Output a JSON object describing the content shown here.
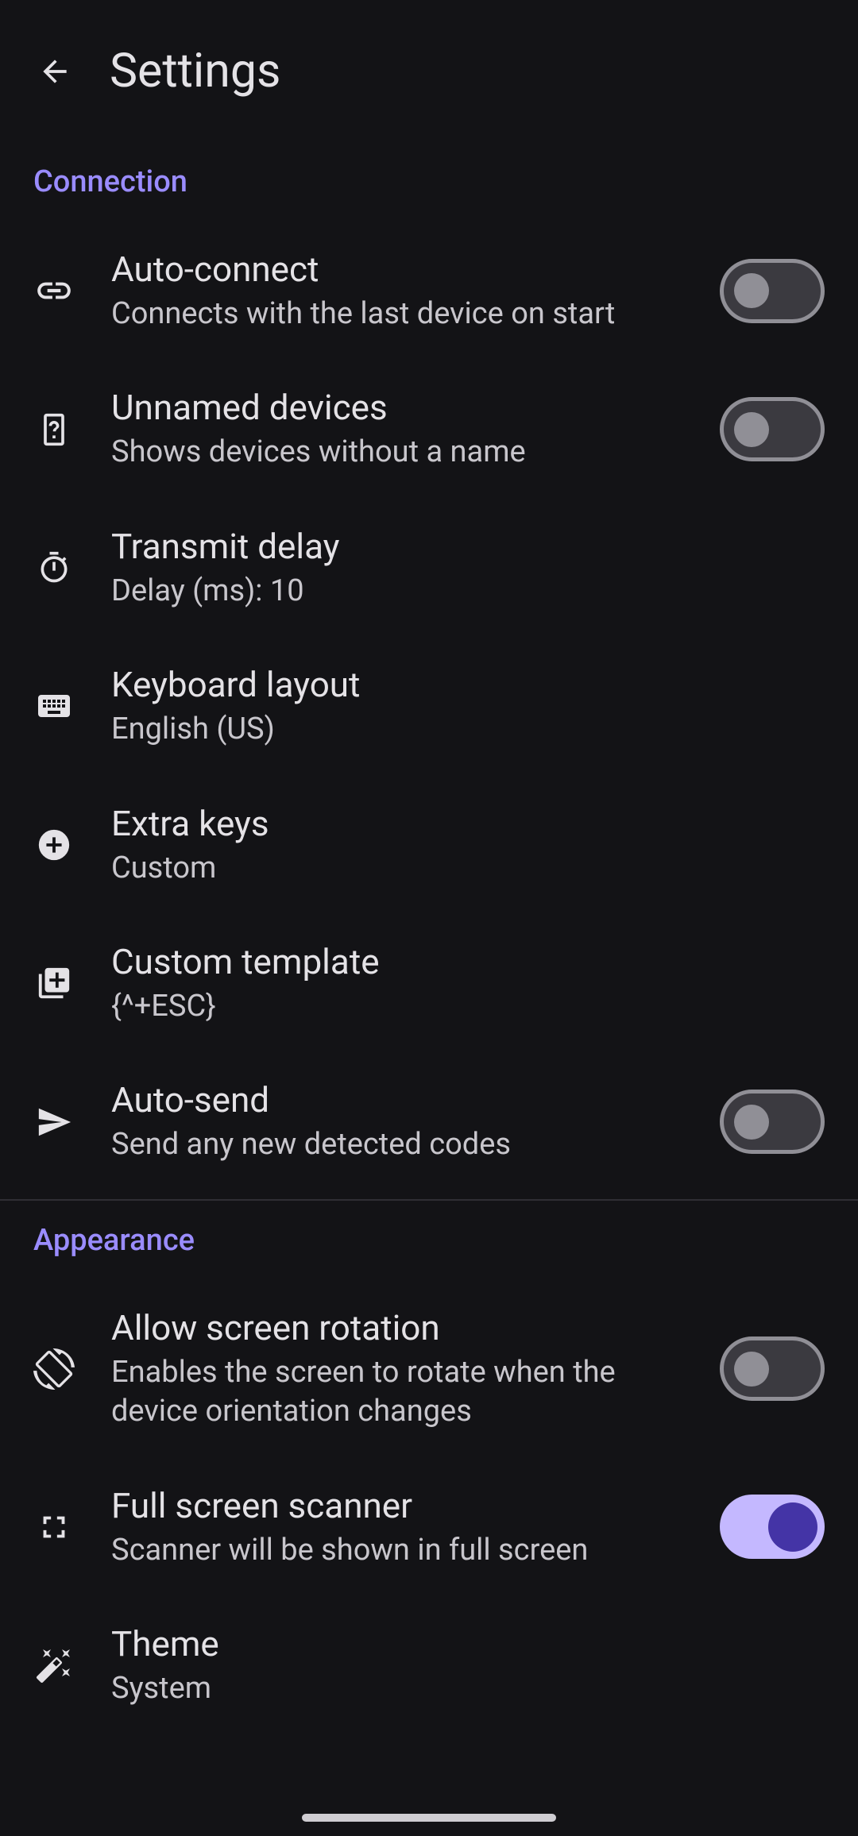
{
  "header": {
    "title": "Settings"
  },
  "sections": {
    "connection": {
      "header": "Connection",
      "auto_connect": {
        "title": "Auto-connect",
        "sub": "Connects with the last device on start"
      },
      "unnamed": {
        "title": "Unnamed devices",
        "sub": "Shows devices without a name"
      },
      "transmit_delay": {
        "title": "Transmit delay",
        "sub": "Delay (ms): 10"
      },
      "keyboard": {
        "title": "Keyboard layout",
        "sub": "English (US)"
      },
      "extra_keys": {
        "title": "Extra keys",
        "sub": "Custom"
      },
      "custom_template": {
        "title": "Custom template",
        "sub": "{^+ESC}"
      },
      "auto_send": {
        "title": "Auto-send",
        "sub": "Send any new detected codes"
      }
    },
    "appearance": {
      "header": "Appearance",
      "rotation": {
        "title": "Allow screen rotation",
        "sub": "Enables the screen to rotate when the device orientation changes"
      },
      "fullscreen": {
        "title": "Full screen scanner",
        "sub": "Scanner will be shown in full screen"
      },
      "theme": {
        "title": "Theme",
        "sub": "System"
      }
    }
  },
  "toggles": {
    "auto_connect": false,
    "unnamed": false,
    "auto_send": false,
    "rotation": false,
    "fullscreen": true
  }
}
